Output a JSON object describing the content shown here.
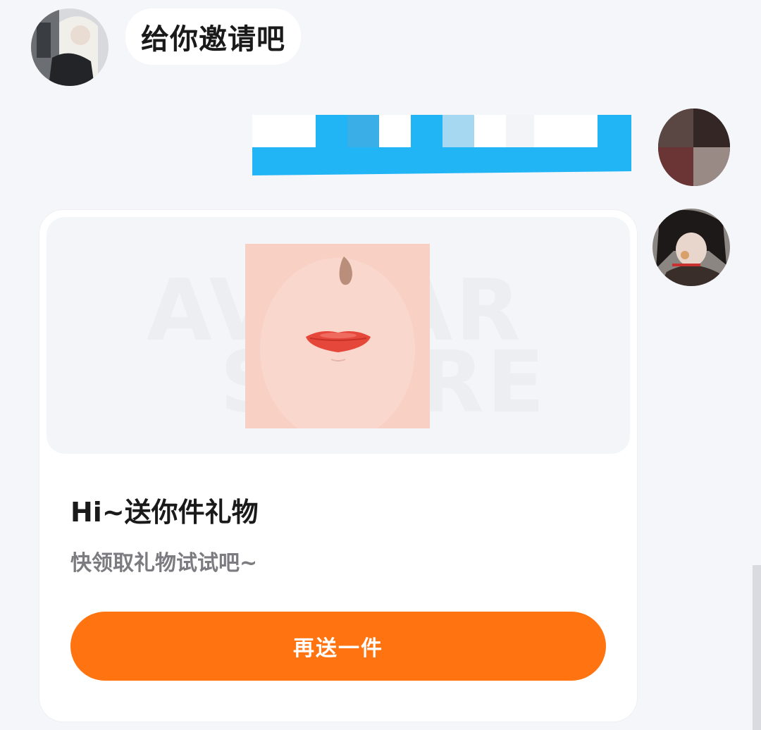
{
  "received_message": {
    "text": "给你邀请吧"
  },
  "gift_card": {
    "title": "Hi~送你件礼物",
    "subtitle": "快领取礼物试试吧~",
    "button_label": "再送一件",
    "watermark_line1": "AVATAR",
    "watermark_line2": "STORE"
  },
  "colors": {
    "background": "#f5f6f9",
    "card": "#ffffff",
    "button": "#ff7410",
    "sent_bubble": "#21b5f5",
    "title_text": "#1a1a1a",
    "subtitle_text": "#7b7b80"
  },
  "icons": {
    "avatar_left": "user-avatar",
    "avatar_right_1": "user-avatar",
    "avatar_right_2": "user-avatar",
    "gift_preview": "face-makeup-item"
  }
}
